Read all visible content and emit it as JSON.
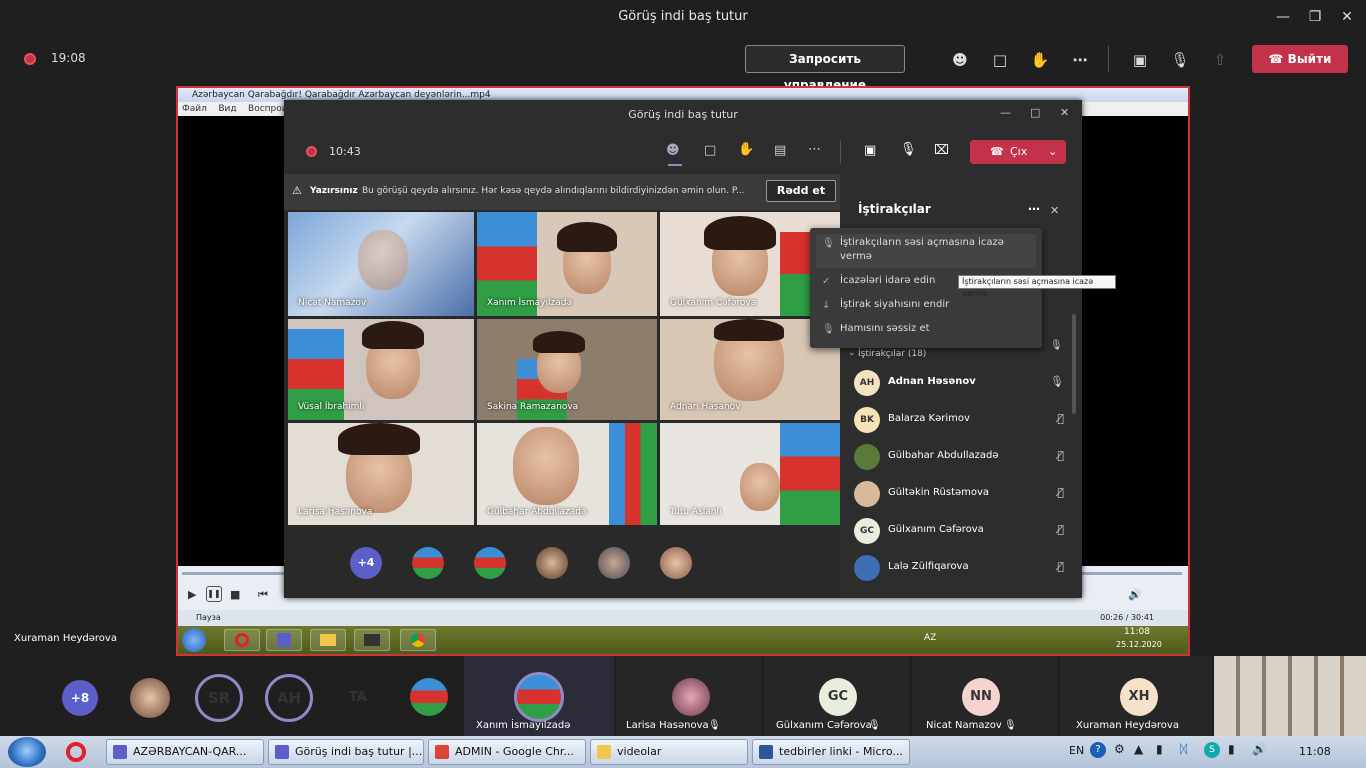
{
  "window": {
    "title": "Görüş indi baş tutur"
  },
  "toolbar": {
    "timer": "19:08",
    "control_label": "Запросить управление",
    "leave_label": "Выйти"
  },
  "share": {
    "player_title": "Azərbaycan Qarabağdır! Qarabağdır Azərbaycan deyənlərin...mp4",
    "menu": [
      "Файл",
      "Вид",
      "Воспроизв"
    ],
    "status": "Пауза",
    "time": "00:26 / 30:41",
    "xp_clock": "11:08",
    "xp_date": "25.12.2020",
    "xp_lang": "AZ"
  },
  "inner": {
    "title": "Görüş indi baş tutur",
    "timer": "10:43",
    "leave_label": "Çıx",
    "warning_bold": "Yazırsınız",
    "warning_text": "Bu görüşü qeydə alırsınız. Hər kəsə qeydə alındıqlarını bildirdiyinizdən əmin olun. P...",
    "dismiss": "Rədd et",
    "tiles": [
      {
        "name": "Nicat Namazov"
      },
      {
        "name": "Xanım İsmayılzadə"
      },
      {
        "name": "Gülxanım Cəfərova"
      },
      {
        "name": "Vüsal İbrahimli"
      },
      {
        "name": "Sakina Ramazanova"
      },
      {
        "name": "Adnan Hasanov"
      },
      {
        "name": "Larisa Hasənova"
      },
      {
        "name": "Gülbahar Abdullazadə"
      },
      {
        "name": "Tutu Aslanlı"
      }
    ],
    "overflow": "+4",
    "panel": {
      "title": "İştirakçılar",
      "section": "İştirakçılar (18)",
      "participants": [
        {
          "initials": "AH",
          "name": "Adnan Həsənov",
          "color": "#f3e3c2"
        },
        {
          "initials": "BK",
          "name": "Balarza Kərimov",
          "color": "#f6e2b4"
        },
        {
          "initials": "",
          "name": "Gülbahar Abdullazadə",
          "color": "#5a7a3a"
        },
        {
          "initials": "",
          "name": "Gültəkin Rüstəmova",
          "color": "#d9b99b"
        },
        {
          "initials": "GC",
          "name": "Gülxanım Cəfərova",
          "color": "#e8eedd"
        },
        {
          "initials": "",
          "name": "Lalə Zülfiqarova",
          "color": "#3d6fb5"
        }
      ]
    },
    "menu": [
      {
        "label_1": "İştirakçıların səsi açmasına icazə",
        "label_2": "vermə"
      },
      {
        "label_1": "İcazələri idarə edin"
      },
      {
        "label_1": "İştirak siyahısını endir"
      },
      {
        "label_1": "Hamısını səssiz et"
      }
    ],
    "tooltip": "İştirakçıların səsi açmasına icazə vermə"
  },
  "presenter_name": "Xuraman Heydərova",
  "strip": {
    "overflow": "+8",
    "avatars": [
      {
        "initials": "SR",
        "color": "#f6d3cf"
      },
      {
        "initials": "AH",
        "color": "#f3e3c2"
      },
      {
        "initials": "TA",
        "color": "#f6e2c9"
      }
    ],
    "tiles": [
      {
        "name": "Xanım İsmayılzadə"
      },
      {
        "name": "Larisa Hasənova"
      },
      {
        "initials": "GC",
        "name": "Gülxanım Cəfərova"
      },
      {
        "initials": "NN",
        "name": "Nicat Namazov"
      },
      {
        "initials": "XH",
        "name": "Xuraman Heydərova"
      }
    ]
  },
  "taskbar": {
    "items": [
      "AZƏRBAYCAN-QAR...",
      "Görüş indi baş tutur |...",
      "ADMIN - Google Chr...",
      "videolar",
      "tedbirler linki - Micro..."
    ],
    "lang": "EN",
    "clock": "11:08"
  }
}
